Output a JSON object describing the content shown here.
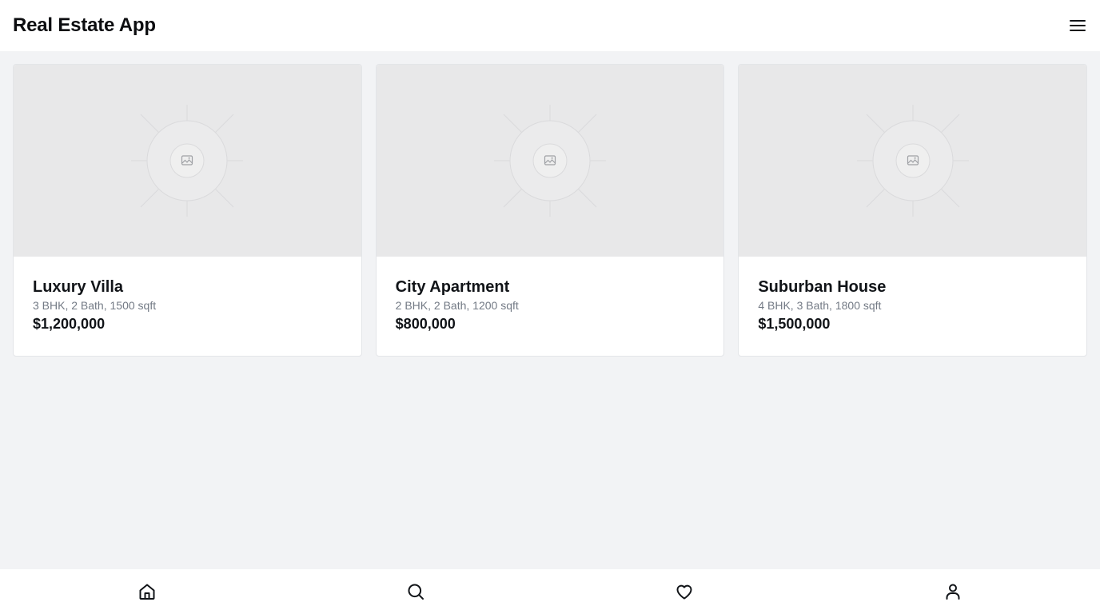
{
  "header": {
    "title": "Real Estate App",
    "menu_icon": "menu-icon"
  },
  "listings": [
    {
      "title": "Luxury Villa",
      "details": "3 BHK, 2 Bath, 1500 sqft",
      "price": "$1,200,000",
      "image_icon": "image-placeholder-icon"
    },
    {
      "title": "City Apartment",
      "details": "2 BHK, 2 Bath, 1200 sqft",
      "price": "$800,000",
      "image_icon": "image-placeholder-icon"
    },
    {
      "title": "Suburban House",
      "details": "4 BHK, 3 Bath, 1800 sqft",
      "price": "$1,500,000",
      "image_icon": "image-placeholder-icon"
    }
  ],
  "bottom_nav": [
    {
      "icon": "home-icon"
    },
    {
      "icon": "search-icon"
    },
    {
      "icon": "heart-icon"
    },
    {
      "icon": "user-icon"
    }
  ],
  "colors": {
    "background": "#f2f3f5",
    "surface": "#ffffff",
    "placeholder": "#e8e8e9",
    "text_primary": "#111418",
    "text_secondary": "#737a85"
  }
}
